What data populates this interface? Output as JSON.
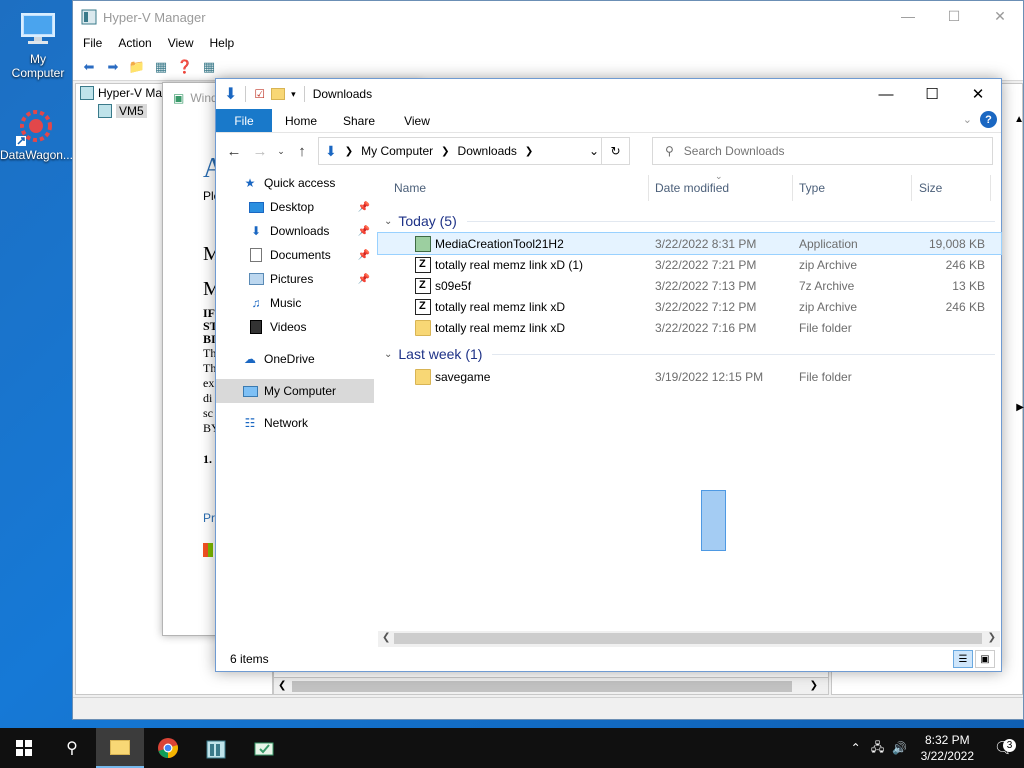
{
  "desktop": {
    "icons": [
      {
        "label": "My Computer",
        "icon": "monitor-icon"
      },
      {
        "label": "DataWagon...",
        "icon": "datawagon-icon"
      }
    ]
  },
  "hyperv": {
    "title": "Hyper-V Manager",
    "menu": [
      "File",
      "Action",
      "View",
      "Help"
    ],
    "tree": {
      "root": "Hyper-V Ma",
      "child": "VM5"
    }
  },
  "setup": {
    "title": "Wind",
    "big_letter": "A",
    "line": "Ple",
    "letters": [
      "M",
      "M"
    ],
    "bold_lines": [
      "IF",
      "ST",
      "BI"
    ],
    "lines": [
      "Th",
      "Th",
      "ex",
      "di",
      "sc",
      "BY"
    ],
    "section": "1.",
    "footer": "Pr"
  },
  "explorer": {
    "title": "Downloads",
    "ribbon": {
      "file": "File",
      "tabs": [
        "Home",
        "Share",
        "View"
      ]
    },
    "address": [
      "My Computer",
      "Downloads"
    ],
    "search_placeholder": "Search Downloads",
    "nav": {
      "quick_access": "Quick access",
      "pinned": [
        "Desktop",
        "Downloads",
        "Documents",
        "Pictures"
      ],
      "unpinned": [
        "Music",
        "Videos"
      ],
      "onedrive": "OneDrive",
      "my_computer": "My Computer",
      "network": "Network"
    },
    "columns": {
      "name": "Name",
      "date": "Date modified",
      "type": "Type",
      "size": "Size"
    },
    "groups": [
      {
        "label": "Today (5)",
        "files": [
          {
            "name": "MediaCreationTool21H2",
            "date": "3/22/2022 8:31 PM",
            "type": "Application",
            "size": "19,008 KB",
            "icon": "app"
          },
          {
            "name": "totally real memz link xD (1)",
            "date": "3/22/2022 7:21 PM",
            "type": "zip Archive",
            "size": "246 KB",
            "icon": "zip"
          },
          {
            "name": "s09e5f",
            "date": "3/22/2022 7:13 PM",
            "type": "7z Archive",
            "size": "13 KB",
            "icon": "zip"
          },
          {
            "name": "totally real memz link xD",
            "date": "3/22/2022 7:12 PM",
            "type": "zip Archive",
            "size": "246 KB",
            "icon": "zip"
          },
          {
            "name": "totally real memz link xD",
            "date": "3/22/2022 7:16 PM",
            "type": "File folder",
            "size": "",
            "icon": "folder"
          }
        ]
      },
      {
        "label": "Last week (1)",
        "files": [
          {
            "name": "savegame",
            "date": "3/19/2022 12:15 PM",
            "type": "File folder",
            "size": "",
            "icon": "folder"
          }
        ]
      }
    ],
    "status": "6 items"
  },
  "taskbar": {
    "time": "8:32 PM",
    "date": "3/22/2022",
    "notifications": "3"
  },
  "colors": {
    "accent": "#1979ca",
    "desktop": "#1679d6",
    "taskbar": "#101010"
  }
}
